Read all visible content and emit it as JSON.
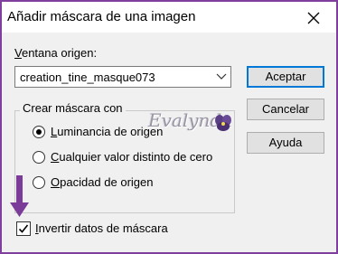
{
  "dialog": {
    "title": "Añadir máscara de una imagen",
    "close_icon": "close-icon"
  },
  "source": {
    "label_accel": "V",
    "label_rest": "entana origen:",
    "selected": "creation_tine_masque073"
  },
  "buttons": {
    "accept": "Aceptar",
    "cancel": "Cancelar",
    "help": "Ayuda"
  },
  "mask_group": {
    "label": "Crear máscara con",
    "options": [
      {
        "accel": "L",
        "rest": "uminancia de origen",
        "selected": true
      },
      {
        "accel": "C",
        "rest": "ualquier valor distinto de cero",
        "selected": false
      },
      {
        "accel": "O",
        "rest": "pacidad de origen",
        "selected": false
      }
    ]
  },
  "invert": {
    "accel": "I",
    "rest": "nvertir datos de máscara",
    "checked": true
  },
  "watermark": {
    "text": "Evalynda"
  },
  "colors": {
    "frame": "#7f3f9c",
    "arrow": "#7b3c99",
    "accent": "#0078d7"
  }
}
